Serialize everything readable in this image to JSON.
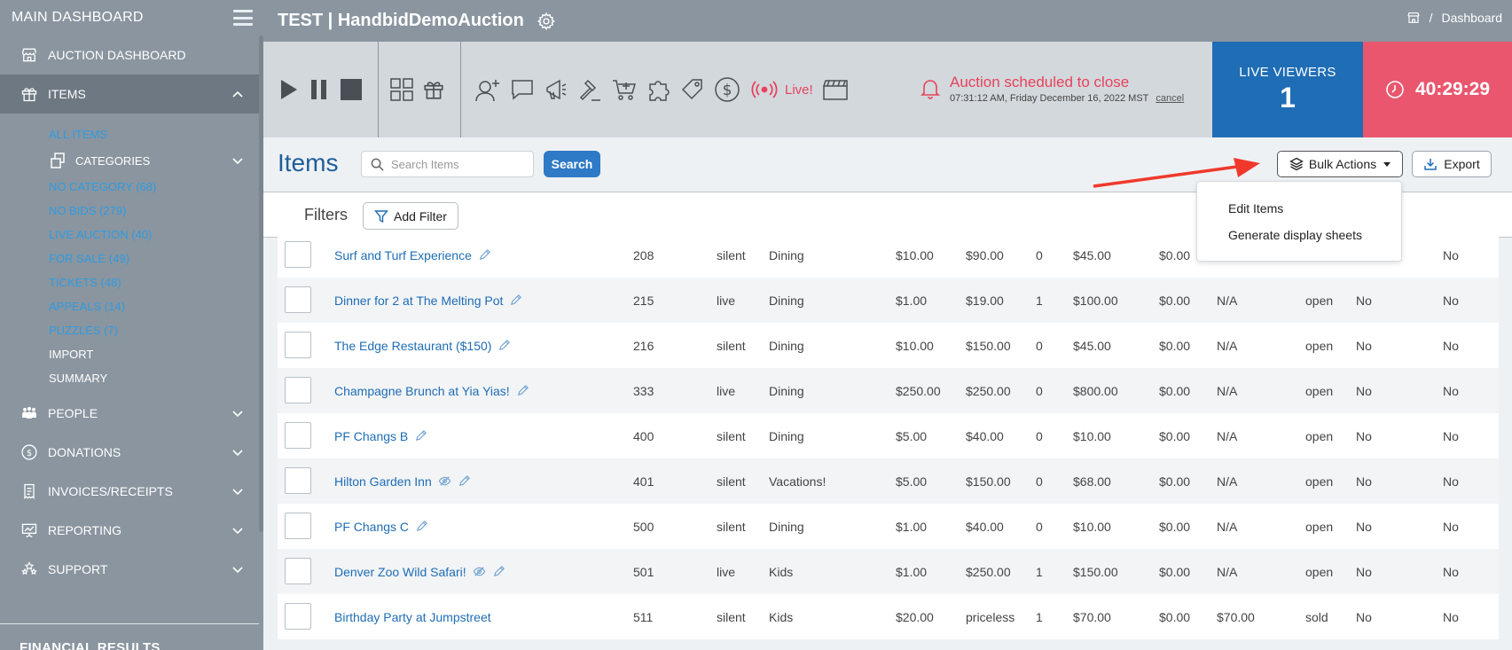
{
  "sidebar": {
    "header": "MAIN DASHBOARD",
    "nav": {
      "auction_dashboard": "AUCTION DASHBOARD",
      "items": "ITEMS",
      "people": "PEOPLE",
      "donations": "DONATIONS",
      "invoices": "INVOICES/RECEIPTS",
      "reporting": "REPORTING",
      "support": "SUPPORT"
    },
    "items_sub": {
      "all_items": "ALL ITEMS",
      "categories": "CATEGORIES",
      "no_category": "NO CATEGORY (68)",
      "no_bids": "NO BIDS (279)",
      "live_auction": "LIVE AUCTION (40)",
      "for_sale": "FOR SALE (49)",
      "tickets": "TICKETS (48)",
      "appeals": "APPEALS (14)",
      "puzzles": "PUZZLES (7)",
      "import": "IMPORT",
      "summary": "SUMMARY"
    },
    "financial": "FINANCIAL RESULTS"
  },
  "topbar": {
    "title": "TEST | HandbidDemoAuction",
    "breadcrumb_sep": "/",
    "breadcrumb": "Dashboard"
  },
  "controls": {
    "live_label": "Live!",
    "alert_title": "Auction scheduled to close",
    "alert_time": "07:31:12 AM, Friday December 16, 2022 MST",
    "cancel": "cancel"
  },
  "live_viewers": {
    "label": "LIVE VIEWERS",
    "count": "1"
  },
  "timer": "40:29:29",
  "items_header": {
    "title": "Items",
    "search_placeholder": "Search Items",
    "search_button": "Search",
    "bulk_actions": "Bulk Actions",
    "export": "Export"
  },
  "filters": {
    "label": "Filters",
    "add_filter": "Add Filter"
  },
  "bulk_menu": {
    "edit_items": "Edit Items",
    "generate_sheets": "Generate display sheets"
  },
  "colors": {
    "accent_blue": "#1f6db5",
    "alert_red": "#e8425a",
    "timer_bg": "#e9566e",
    "sidebar_bg": "#8a959f"
  },
  "rows": [
    {
      "name": "Surf and Turf Experience",
      "num": "208",
      "type": "silent",
      "category": "Dining",
      "col1": "$10.00",
      "col2": "$90.00",
      "bids": "0",
      "col3": "$45.00",
      "col4": "$0.00",
      "col5": "",
      "status": "",
      "flag1": "",
      "flag2": "No",
      "hidden": false
    },
    {
      "name": "Dinner for 2 at The Melting Pot",
      "num": "215",
      "type": "live",
      "category": "Dining",
      "col1": "$1.00",
      "col2": "$19.00",
      "bids": "1",
      "col3": "$100.00",
      "col4": "$0.00",
      "col5": "N/A",
      "status": "open",
      "flag1": "No",
      "flag2": "No",
      "hidden": false
    },
    {
      "name": "The Edge Restaurant ($150)",
      "num": "216",
      "type": "silent",
      "category": "Dining",
      "col1": "$10.00",
      "col2": "$150.00",
      "bids": "0",
      "col3": "$45.00",
      "col4": "$0.00",
      "col5": "N/A",
      "status": "open",
      "flag1": "No",
      "flag2": "No",
      "hidden": false
    },
    {
      "name": "Champagne Brunch at Yia Yias!",
      "num": "333",
      "type": "live",
      "category": "Dining",
      "col1": "$250.00",
      "col2": "$250.00",
      "bids": "0",
      "col3": "$800.00",
      "col4": "$0.00",
      "col5": "N/A",
      "status": "open",
      "flag1": "No",
      "flag2": "No",
      "hidden": false
    },
    {
      "name": "PF Changs B",
      "num": "400",
      "type": "silent",
      "category": "Dining",
      "col1": "$5.00",
      "col2": "$40.00",
      "bids": "0",
      "col3": "$10.00",
      "col4": "$0.00",
      "col5": "N/A",
      "status": "open",
      "flag1": "No",
      "flag2": "No",
      "hidden": false
    },
    {
      "name": "Hilton Garden Inn",
      "num": "401",
      "type": "silent",
      "category": "Vacations!",
      "col1": "$5.00",
      "col2": "$150.00",
      "bids": "0",
      "col3": "$68.00",
      "col4": "$0.00",
      "col5": "N/A",
      "status": "open",
      "flag1": "No",
      "flag2": "No",
      "hidden": true
    },
    {
      "name": "PF Changs C",
      "num": "500",
      "type": "silent",
      "category": "Dining",
      "col1": "$1.00",
      "col2": "$40.00",
      "bids": "0",
      "col3": "$10.00",
      "col4": "$0.00",
      "col5": "N/A",
      "status": "open",
      "flag1": "No",
      "flag2": "No",
      "hidden": false
    },
    {
      "name": "Denver Zoo Wild Safari!",
      "num": "501",
      "type": "live",
      "category": "Kids",
      "col1": "$1.00",
      "col2": "$250.00",
      "bids": "1",
      "col3": "$150.00",
      "col4": "$0.00",
      "col5": "N/A",
      "status": "open",
      "flag1": "No",
      "flag2": "No",
      "hidden": true
    },
    {
      "name": "Birthday Party at Jumpstreet",
      "num": "511",
      "type": "silent",
      "category": "Kids",
      "col1": "$20.00",
      "col2": "priceless",
      "bids": "1",
      "col3": "$70.00",
      "col4": "$0.00",
      "col5": "$70.00",
      "status": "sold",
      "flag1": "No",
      "flag2": "No",
      "hidden": false
    }
  ]
}
